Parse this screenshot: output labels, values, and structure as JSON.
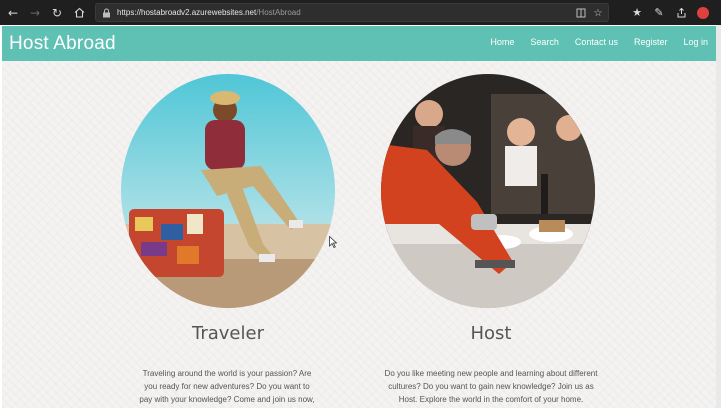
{
  "browser": {
    "url_host": "https://hostabroadv2.azurewebsites.net",
    "url_path": "/HostAbroad",
    "icons": {
      "back": "back-arrow-icon",
      "forward": "forward-arrow-icon",
      "refresh": "refresh-icon",
      "home": "home-icon",
      "lock": "lock-icon",
      "reading_view": "reading-view-icon",
      "favorite": "star-icon",
      "favorites_bar": "favorites-icon",
      "notes": "pen-icon",
      "share": "share-icon",
      "profile": "profile-icon"
    }
  },
  "site": {
    "brand": "Host Abroad",
    "nav": [
      "Home",
      "Search",
      "Contact us",
      "Register",
      "Log in"
    ],
    "colors": {
      "header": "#5fc0b4",
      "text": "#555555"
    }
  },
  "cards": {
    "traveler": {
      "title": "Traveler",
      "text": "Traveling around the world is your passion? Are you ready for new adventures? Do you want to pay with your knowledge? Come and join us now, Traveler"
    },
    "host": {
      "title": "Host",
      "text": "Do you like meeting new people and learning about different cultures? Do you want to gain new knowledge? Join us as Host. Explore the world in the comfort of your home."
    }
  }
}
